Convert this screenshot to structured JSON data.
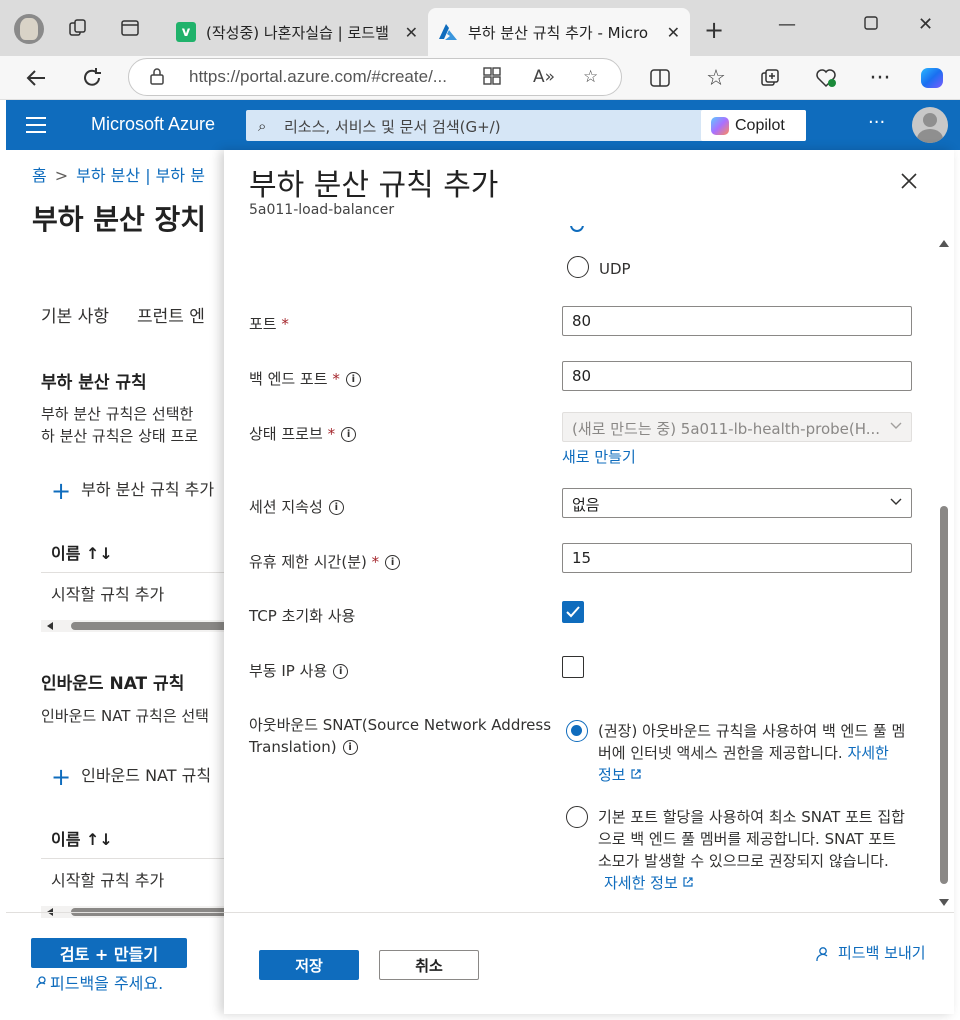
{
  "browser": {
    "tabs": [
      {
        "title": "(작성중) 나혼자실습 | 로드밸",
        "favicon_letter": "v",
        "favicon_color": "#20b26b"
      },
      {
        "title": "부하 분산 규칙 추가 - Micro",
        "favicon_color": "#0f6cbd"
      }
    ],
    "url": "https://portal.azure.com/#create/..."
  },
  "azure": {
    "brand": "Microsoft Azure",
    "search_placeholder": "리소스, 서비스 및 문서 검색(G+/)",
    "copilot_label": "Copilot",
    "more": "···"
  },
  "background_page": {
    "breadcrumb": [
      "홈",
      "부하 분산 | 부하 분"
    ],
    "title": "부하 분산 장치",
    "tabs": [
      "기본 사항",
      "프런트 엔"
    ],
    "lb_rules": {
      "heading": "부하 분산 규칙",
      "desc_line1": "부하 분산 규칙은 선택한",
      "desc_line2": "하 분산 규칙은 상태 프로",
      "add": "부하 분산 규칙 추가",
      "col_name": "이름 ↑↓",
      "empty_row": "시작할 규칙 추가"
    },
    "nat_rules": {
      "heading": "인바운드 NAT 규칙",
      "desc_line1": "인바운드 NAT 규칙은 선택",
      "add": "인바운드 NAT 규칙",
      "col_name": "이름 ↑↓",
      "empty_row": "시작할 규칙 추가"
    },
    "review_create": "검토 + 만들기",
    "feedback": "피드백을 주세요."
  },
  "panel": {
    "title": "부하 분산 규칙 추가",
    "subtitle": "5a011-load-balancer",
    "protocol_udp": "UDP",
    "port": {
      "label": "포트",
      "value": "80"
    },
    "backend_port": {
      "label": "백 엔드 포트",
      "value": "80"
    },
    "health_probe": {
      "label": "상태 프로브",
      "value": "(새로 만드는 중) 5a011-lb-health-probe(H...",
      "create_new": "새로 만들기"
    },
    "session_persistence": {
      "label": "세션 지속성",
      "value": "없음"
    },
    "idle_timeout": {
      "label": "유휴 제한 시간(분)",
      "value": "15"
    },
    "tcp_reset": {
      "label": "TCP 초기화 사용",
      "checked": true
    },
    "floating_ip": {
      "label": "부동 IP 사용",
      "checked": false
    },
    "snat": {
      "label_line1": "아웃바운드 SNAT(Source Network Address",
      "label_line2": "Translation)",
      "option1_line1": "(권장) 아웃바운드 규칙을 사용하여 백 엔드 풀 멤",
      "option1_line2": "버에 인터넷 액세스 권한을 제공합니다.",
      "option1_link_a": "자세한",
      "option1_link_b": "정보",
      "option2_line1": "기본 포트 할당을 사용하여 최소 SNAT 포트 집합",
      "option2_line2": "으로 백 엔드 풀 멤버를 제공합니다. SNAT 포트",
      "option2_line3": "소모가 발생할 수 있으므로 권장되지 않습니다.",
      "option2_link": "자세한 정보",
      "selected": 1
    },
    "save": "저장",
    "cancel": "취소",
    "send_feedback": "피드백 보내기"
  },
  "colors": {
    "accent": "#0f6cbd",
    "required": "#a4262c"
  }
}
